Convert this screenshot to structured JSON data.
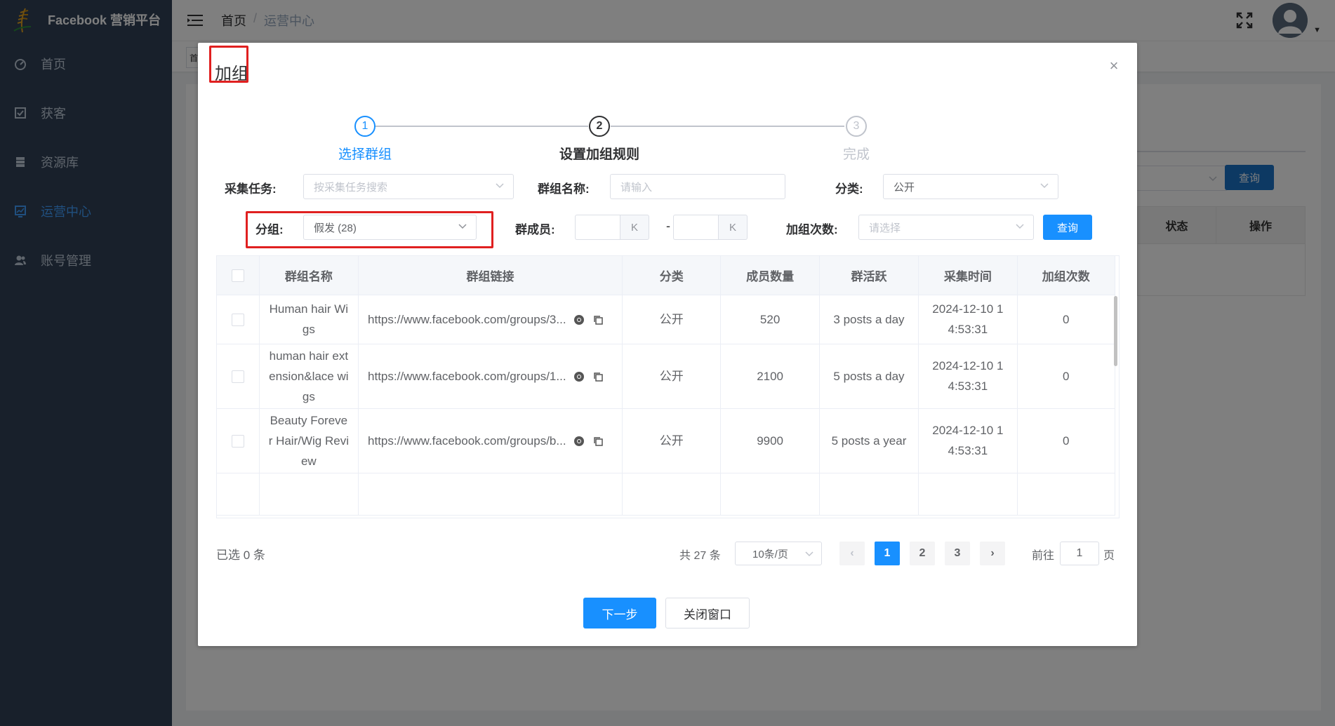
{
  "app": {
    "title": "Facebook 营销平台"
  },
  "sidebar": {
    "items": [
      {
        "label": "首页",
        "icon": "dashboard-icon"
      },
      {
        "label": "获客",
        "icon": "checklist-icon"
      },
      {
        "label": "资源库",
        "icon": "list-icon"
      },
      {
        "label": "运营中心",
        "icon": "chart-icon",
        "active": true
      },
      {
        "label": "账号管理",
        "icon": "users-icon"
      }
    ]
  },
  "header": {
    "breadcrumb": [
      "首页",
      "运营中心"
    ],
    "breadcrumb_sep": "/"
  },
  "background": {
    "tag": "首",
    "query_label": "查询",
    "columns": [
      "状态",
      "操作"
    ]
  },
  "dialog": {
    "title": "加组",
    "steps": [
      {
        "num": "1",
        "label": "选择群组"
      },
      {
        "num": "2",
        "label": "设置加组规则"
      },
      {
        "num": "3",
        "label": "完成"
      }
    ],
    "form": {
      "task_label": "采集任务:",
      "task_placeholder": "按采集任务搜索",
      "group_name_label": "群组名称:",
      "group_name_placeholder": "请输入",
      "category_label": "分类:",
      "category_value": "公开",
      "group_label": "分组:",
      "group_value": "假发 (28)",
      "members_label": "群成员:",
      "k_suffix": "K",
      "range_dash": "-",
      "join_count_label": "加组次数:",
      "join_count_placeholder": "请选择",
      "query_label": "查询"
    },
    "table": {
      "columns": [
        "群组名称",
        "群组链接",
        "分类",
        "成员数量",
        "群活跃",
        "采集时间",
        "加组次数"
      ],
      "rows": [
        {
          "name_lines": [
            "Human hair Wi",
            "gs"
          ],
          "link": "https://www.facebook.com/groups/3...",
          "category": "公开",
          "members": "520",
          "activity": "3 posts a day",
          "time_lines": [
            "2024-12-10 1",
            "4:53:31"
          ],
          "joins": "0"
        },
        {
          "name_lines": [
            "human hair ext",
            "ension&lace wi",
            "gs"
          ],
          "link": "https://www.facebook.com/groups/1...",
          "category": "公开",
          "members": "2100",
          "activity": "5 posts a day",
          "time_lines": [
            "2024-12-10 1",
            "4:53:31"
          ],
          "joins": "0"
        },
        {
          "name_lines": [
            "Beauty Foreve",
            "r Hair/Wig Revi",
            "ew"
          ],
          "link": "https://www.facebook.com/groups/b...",
          "category": "公开",
          "members": "9900",
          "activity": "5 posts a year",
          "time_lines": [
            "2024-12-10 1",
            "4:53:31"
          ],
          "joins": "0"
        }
      ]
    },
    "footer": {
      "selected": "已选 0 条",
      "total": "共 27 条",
      "page_size": "10条/页",
      "pages": [
        "1",
        "2",
        "3"
      ],
      "current_page": "1",
      "goto_prefix": "前往",
      "goto_value": "1",
      "goto_suffix": "页",
      "prev": "‹",
      "next": "›"
    },
    "buttons": {
      "next": "下一步",
      "close": "关闭窗口"
    }
  },
  "colors": {
    "primary": "#1890ff",
    "sidebar_bg": "#304156",
    "highlight": "#e02020"
  }
}
